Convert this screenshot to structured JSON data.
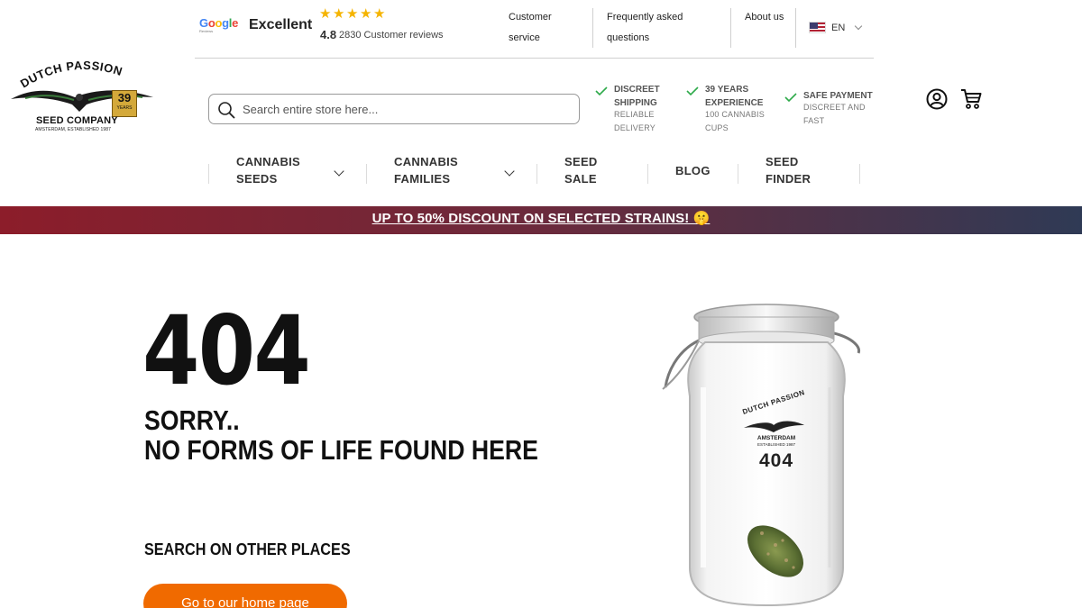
{
  "reviews": {
    "provider_logo_text": "Google",
    "provider_logo_sub": "Reviews",
    "rating_word": "Excellent",
    "stars": 5,
    "score": "4.8",
    "count_text": "2830 Customer reviews"
  },
  "top_links": {
    "customer_service": "Customer service",
    "faq": "Frequently asked questions",
    "about": "About us",
    "language": "EN"
  },
  "logo": {
    "brand": "DUTCH PASSION",
    "company": "SEED COMPANY",
    "tagline": "AMSTERDAM, ESTABLISHED 1987",
    "badge_number": "39",
    "badge_unit": "YEARS"
  },
  "search": {
    "placeholder": "Search entire store here..."
  },
  "usps": [
    {
      "title": "DISCREET SHIPPING",
      "subtitle": "RELIABLE DELIVERY"
    },
    {
      "title": "39 YEARS EXPERIENCE",
      "subtitle": "100 CANNABIS CUPS"
    },
    {
      "title": "SAFE PAYMENT",
      "subtitle": "DISCREET AND FAST"
    }
  ],
  "nav": {
    "cannabis_seeds": "CANNABIS SEEDS",
    "cannabis_families": "CANNABIS FAMILIES",
    "seed_sale": "SEED SALE",
    "blog": "BLOG",
    "seed_finder": "SEED FINDER"
  },
  "promo": {
    "text": "UP TO 50% DISCOUNT ON SELECTED STRAINS! 🤫"
  },
  "error": {
    "code": "404",
    "line1": "SORRY..",
    "line2": "NO FORMS OF LIFE FOUND HERE",
    "other_places": "SEARCH ON OTHER PLACES",
    "home_button": "Go to our home page"
  },
  "jar": {
    "brand": "DUTCH PASSION",
    "city": "AMSTERDAM",
    "established": "ESTABLISHED 1987",
    "number": "404"
  },
  "colors": {
    "accent_orange": "#f06a00",
    "check_green": "#2eaa4a",
    "star_gold": "#f5b400",
    "promo_red": "#8c1d2a",
    "promo_navy": "#2f3a55"
  },
  "icons": [
    "search-icon",
    "check-icon",
    "account-icon",
    "cart-icon",
    "chevron-down-icon",
    "us-flag-icon",
    "star-icon"
  ]
}
